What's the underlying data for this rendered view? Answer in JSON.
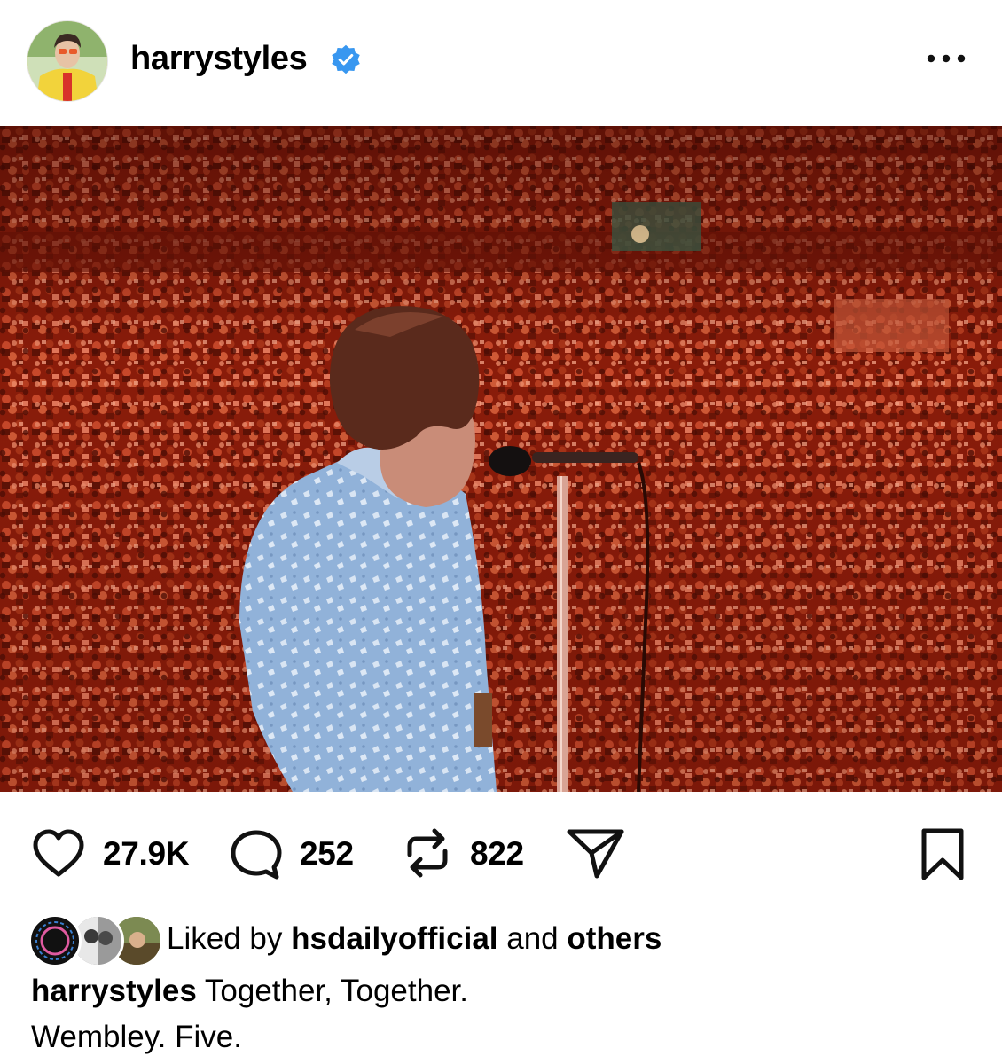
{
  "post": {
    "username": "harrystyles",
    "verified": true,
    "more_icon": "more-horizontal-icon"
  },
  "actions": {
    "likes": "27.9K",
    "comments": "252",
    "reposts": "822",
    "icons": [
      "heart-icon",
      "comment-icon",
      "repost-icon",
      "share-icon",
      "bookmark-icon"
    ]
  },
  "liked_by": {
    "prefix": "Liked by",
    "user": "hsdailyofficial",
    "conjunction": "and",
    "others": "others"
  },
  "caption": {
    "user": "harrystyles",
    "line1": "Together, Together.",
    "line2": "Wembley. Five."
  },
  "colors": {
    "verified_blue": "#3897f0",
    "photo_red": "#b42a12"
  }
}
